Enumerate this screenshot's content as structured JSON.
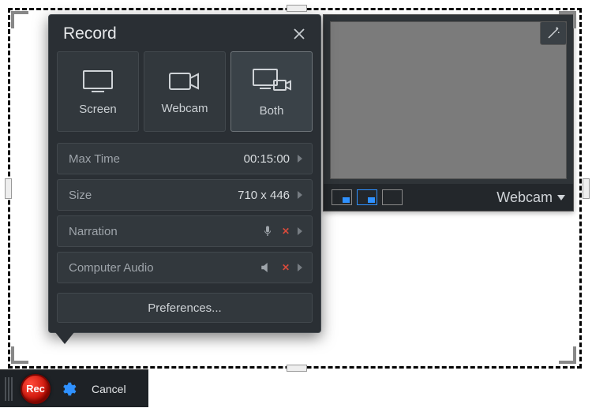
{
  "popup": {
    "title": "Record",
    "sources": {
      "screen": "Screen",
      "webcam": "Webcam",
      "both": "Both"
    },
    "max_time": {
      "label": "Max Time",
      "value": "00:15:00"
    },
    "size": {
      "label": "Size",
      "value": "710 x 446"
    },
    "narration": {
      "label": "Narration"
    },
    "computer_audio": {
      "label": "Computer Audio"
    },
    "preferences": "Preferences..."
  },
  "webcam_panel": {
    "label": "Webcam"
  },
  "toolbar": {
    "rec": "Rec",
    "cancel": "Cancel"
  }
}
